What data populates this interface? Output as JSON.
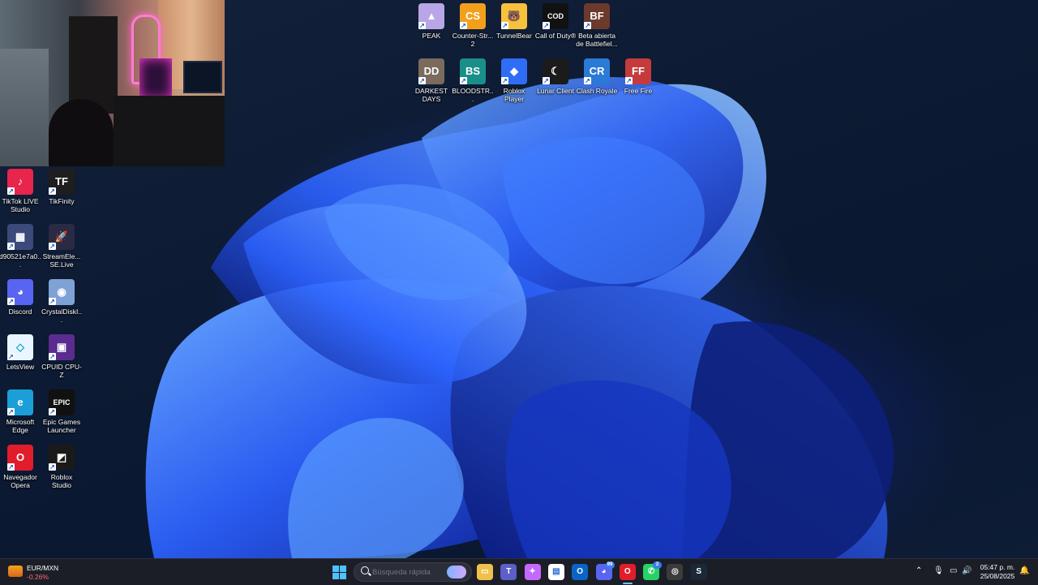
{
  "desktop": {
    "top_row_1": [
      {
        "label": "PEAK",
        "name": "peak",
        "color": "#b9a6e6",
        "glyph": "▲"
      },
      {
        "label": "Counter-Str... 2",
        "name": "counter-strike-2",
        "color": "#f2a01c",
        "glyph": "CS"
      },
      {
        "label": "TunnelBear",
        "name": "tunnelbear",
        "color": "#f7c23b",
        "glyph": "🐻"
      },
      {
        "label": "Call of Duty®",
        "name": "call-of-duty",
        "color": "#111111",
        "glyph": "COD"
      },
      {
        "label": "Beta abierta de Battlefiel...",
        "name": "battlefield-beta",
        "color": "#6b3a2c",
        "glyph": "BF"
      }
    ],
    "top_row_2": [
      {
        "label": "DARKEST DAYS",
        "name": "darkest-days",
        "color": "#7a6b5c",
        "glyph": "DD"
      },
      {
        "label": "BLOODSTR...",
        "name": "bloodstrike",
        "color": "#1a8f8a",
        "glyph": "BS"
      },
      {
        "label": "Roblox Player",
        "name": "roblox-player",
        "color": "#2f6df6",
        "glyph": "◆"
      },
      {
        "label": "Lunar Client",
        "name": "lunar-client",
        "color": "#1b1b1b",
        "glyph": "☾"
      },
      {
        "label": "Clash Royale",
        "name": "clash-royale",
        "color": "#2b7ad6",
        "glyph": "CR"
      },
      {
        "label": "Free Fire",
        "name": "free-fire",
        "color": "#c53b3b",
        "glyph": "FF"
      }
    ],
    "left_col_1": [
      {
        "label": "TikTok LIVE Studio",
        "name": "tiktok-live-studio",
        "color": "#e8254a",
        "glyph": "♪"
      },
      {
        "label": "d90521e7a0...",
        "name": "video-file",
        "color": "#3b4a7a",
        "glyph": "▦"
      },
      {
        "label": "Discord",
        "name": "discord",
        "color": "#5865f2",
        "glyph": "◕"
      },
      {
        "label": "LetsView",
        "name": "letsview",
        "color": "#e9f6ff",
        "glyph": "◇"
      },
      {
        "label": "Microsoft Edge",
        "name": "microsoft-edge",
        "color": "#1c9fd8",
        "glyph": "e"
      },
      {
        "label": "Navegador Opera",
        "name": "opera",
        "color": "#e11d2b",
        "glyph": "O"
      }
    ],
    "left_col_2": [
      {
        "label": "TikFinity",
        "name": "tikfinity",
        "color": "#1e1e1e",
        "glyph": "TF"
      },
      {
        "label": "StreamEle... SE.Live",
        "name": "streamelements",
        "color": "#2a2a44",
        "glyph": "🚀"
      },
      {
        "label": "CrystalDiskI...",
        "name": "crystaldiskinfo",
        "color": "#7fa2d6",
        "glyph": "◉"
      },
      {
        "label": "CPUID CPU-Z",
        "name": "cpu-z",
        "color": "#5b2c8f",
        "glyph": "▣"
      },
      {
        "label": "Epic Games Launcher",
        "name": "epic-games",
        "color": "#111111",
        "glyph": "EPIC"
      },
      {
        "label": "Roblox Studio",
        "name": "roblox-studio",
        "color": "#1a1a1a",
        "glyph": "◩"
      }
    ]
  },
  "taskbar": {
    "widget": {
      "title": "EUR/MXN",
      "change": "-0.26%"
    },
    "search": {
      "placeholder": "Búsqueda rápida"
    },
    "apps": [
      {
        "name": "file-explorer",
        "glyph": "▭",
        "color": "#f1c04b"
      },
      {
        "name": "teams",
        "glyph": "T",
        "color": "#5b5fc7"
      },
      {
        "name": "copilot",
        "glyph": "✦",
        "color": "#c468ff"
      },
      {
        "name": "microsoft-store",
        "glyph": "▤",
        "color": "#ffffff"
      },
      {
        "name": "outlook",
        "glyph": "O",
        "color": "#0a64c8"
      },
      {
        "name": "discord",
        "glyph": "◕",
        "color": "#5865f2",
        "badge": "99"
      },
      {
        "name": "opera",
        "glyph": "O",
        "color": "#e11d2b"
      },
      {
        "name": "whatsapp",
        "glyph": "✆",
        "color": "#25d366",
        "badge": "2"
      },
      {
        "name": "chrome",
        "glyph": "◎",
        "color": "#3b3b3b"
      },
      {
        "name": "steam",
        "glyph": "S",
        "color": "#1b2838"
      }
    ],
    "clock": {
      "time": "05:47 p. m.",
      "date": "25/08/2025"
    }
  }
}
